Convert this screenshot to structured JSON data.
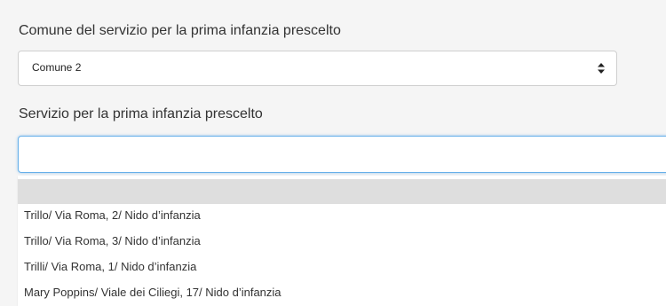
{
  "form": {
    "comune_label": "Comune del servizio per la prima infanzia prescelto",
    "comune_value": "Comune 2",
    "servizio_label": "Servizio per la prima infanzia prescelto",
    "servizio_value": "",
    "servizio_options": [
      "Trillo/ Via Roma, 2/ Nido d’infanzia",
      "Trillo/ Via Roma, 3/ Nido d’infanzia",
      "Trilli/ Via Roma, 1/ Nido d’infanzia",
      "Mary Poppins/ Viale dei Ciliegi, 17/ Nido d’infanzia"
    ]
  },
  "icons": {
    "select_arrows": "sort-arrows-icon"
  },
  "colors": {
    "focus_border": "#66afe9",
    "highlighted_option": "#dedede",
    "page_background": "#f5f5f5"
  }
}
